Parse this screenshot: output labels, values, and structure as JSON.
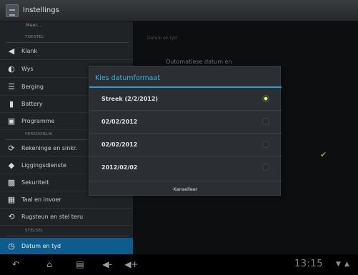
{
  "app": {
    "title": "Instellings"
  },
  "sidebar": {
    "top_item": "Meer...",
    "sections": [
      {
        "caption": "TOESTEL",
        "items": [
          {
            "label": "Klank",
            "icon": "speaker-icon"
          },
          {
            "label": "Wys",
            "icon": "display-icon"
          },
          {
            "label": "Berging",
            "icon": "storage-icon"
          },
          {
            "label": "Battery",
            "icon": "battery-icon"
          },
          {
            "label": "Programme",
            "icon": "apps-icon"
          }
        ]
      },
      {
        "caption": "PERSOONLIK",
        "items": [
          {
            "label": "Rekeninge en sinkr.",
            "icon": "sync-icon"
          },
          {
            "label": "Liggingsdienste",
            "icon": "location-icon"
          },
          {
            "label": "Sekuriteit",
            "icon": "lock-icon"
          },
          {
            "label": "Taal en invoer",
            "icon": "keyboard-icon"
          },
          {
            "label": "Rugsteun en stel teru",
            "icon": "restore-icon"
          }
        ]
      },
      {
        "caption": "STELSEL",
        "items": [
          {
            "label": "Datum en tyd",
            "icon": "clock-icon",
            "selected": true
          }
        ]
      }
    ]
  },
  "detail": {
    "faded_header": "Datum en tyd",
    "faded_item": "Outomatiese datum en"
  },
  "dialog": {
    "title": "Kies datumformaat",
    "options": [
      {
        "label": "Streek (2/2/2012)",
        "selected": true
      },
      {
        "label": "02/02/2012",
        "selected": false
      },
      {
        "label": "02/02/2012",
        "selected": false
      },
      {
        "label": "2012/02/02",
        "selected": false
      }
    ],
    "cancel_label": "Kanselleer"
  },
  "status": {
    "time": "13:15"
  },
  "colors": {
    "accent": "#33b5e5",
    "selection": "#0e5c8c",
    "radio_on": "#e6f24a"
  }
}
